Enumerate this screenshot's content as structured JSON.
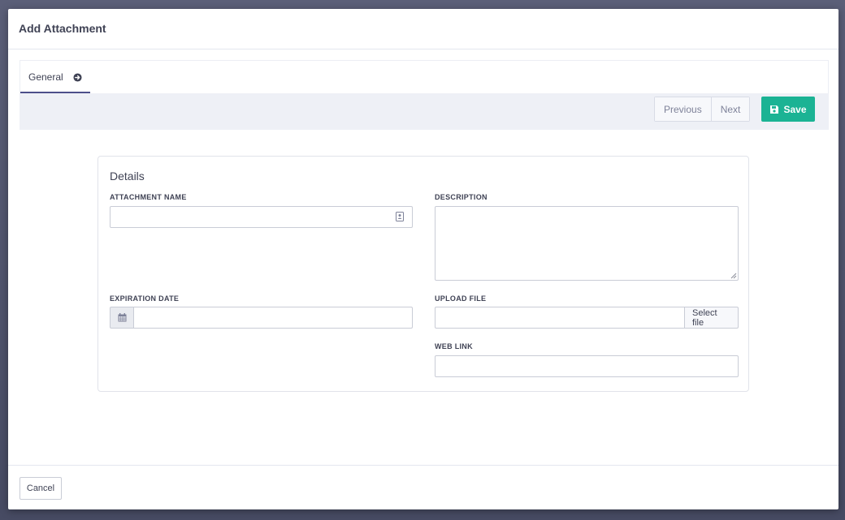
{
  "modal": {
    "title": "Add Attachment"
  },
  "tabs": [
    {
      "label": "General",
      "icon": "arrow-circle-right-icon",
      "active": true
    }
  ],
  "toolbar": {
    "previous_label": "Previous",
    "next_label": "Next",
    "save_label": "Save",
    "save_color": "#1bb394"
  },
  "details": {
    "title": "Details",
    "attachment_name": {
      "label": "ATTACHMENT NAME",
      "value": ""
    },
    "description": {
      "label": "DESCRIPTION",
      "value": ""
    },
    "expiration_date": {
      "label": "EXPIRATION DATE",
      "value": "",
      "icon": "calendar-icon"
    },
    "upload_file": {
      "label": "UPLOAD FILE",
      "value": "",
      "button_label": "Select file"
    },
    "web_link": {
      "label": "WEB LINK",
      "value": ""
    }
  },
  "footer": {
    "cancel_label": "Cancel"
  },
  "colors": {
    "tab_accent": "#4c4f8a",
    "toolbar_bg": "#eef0f6"
  }
}
